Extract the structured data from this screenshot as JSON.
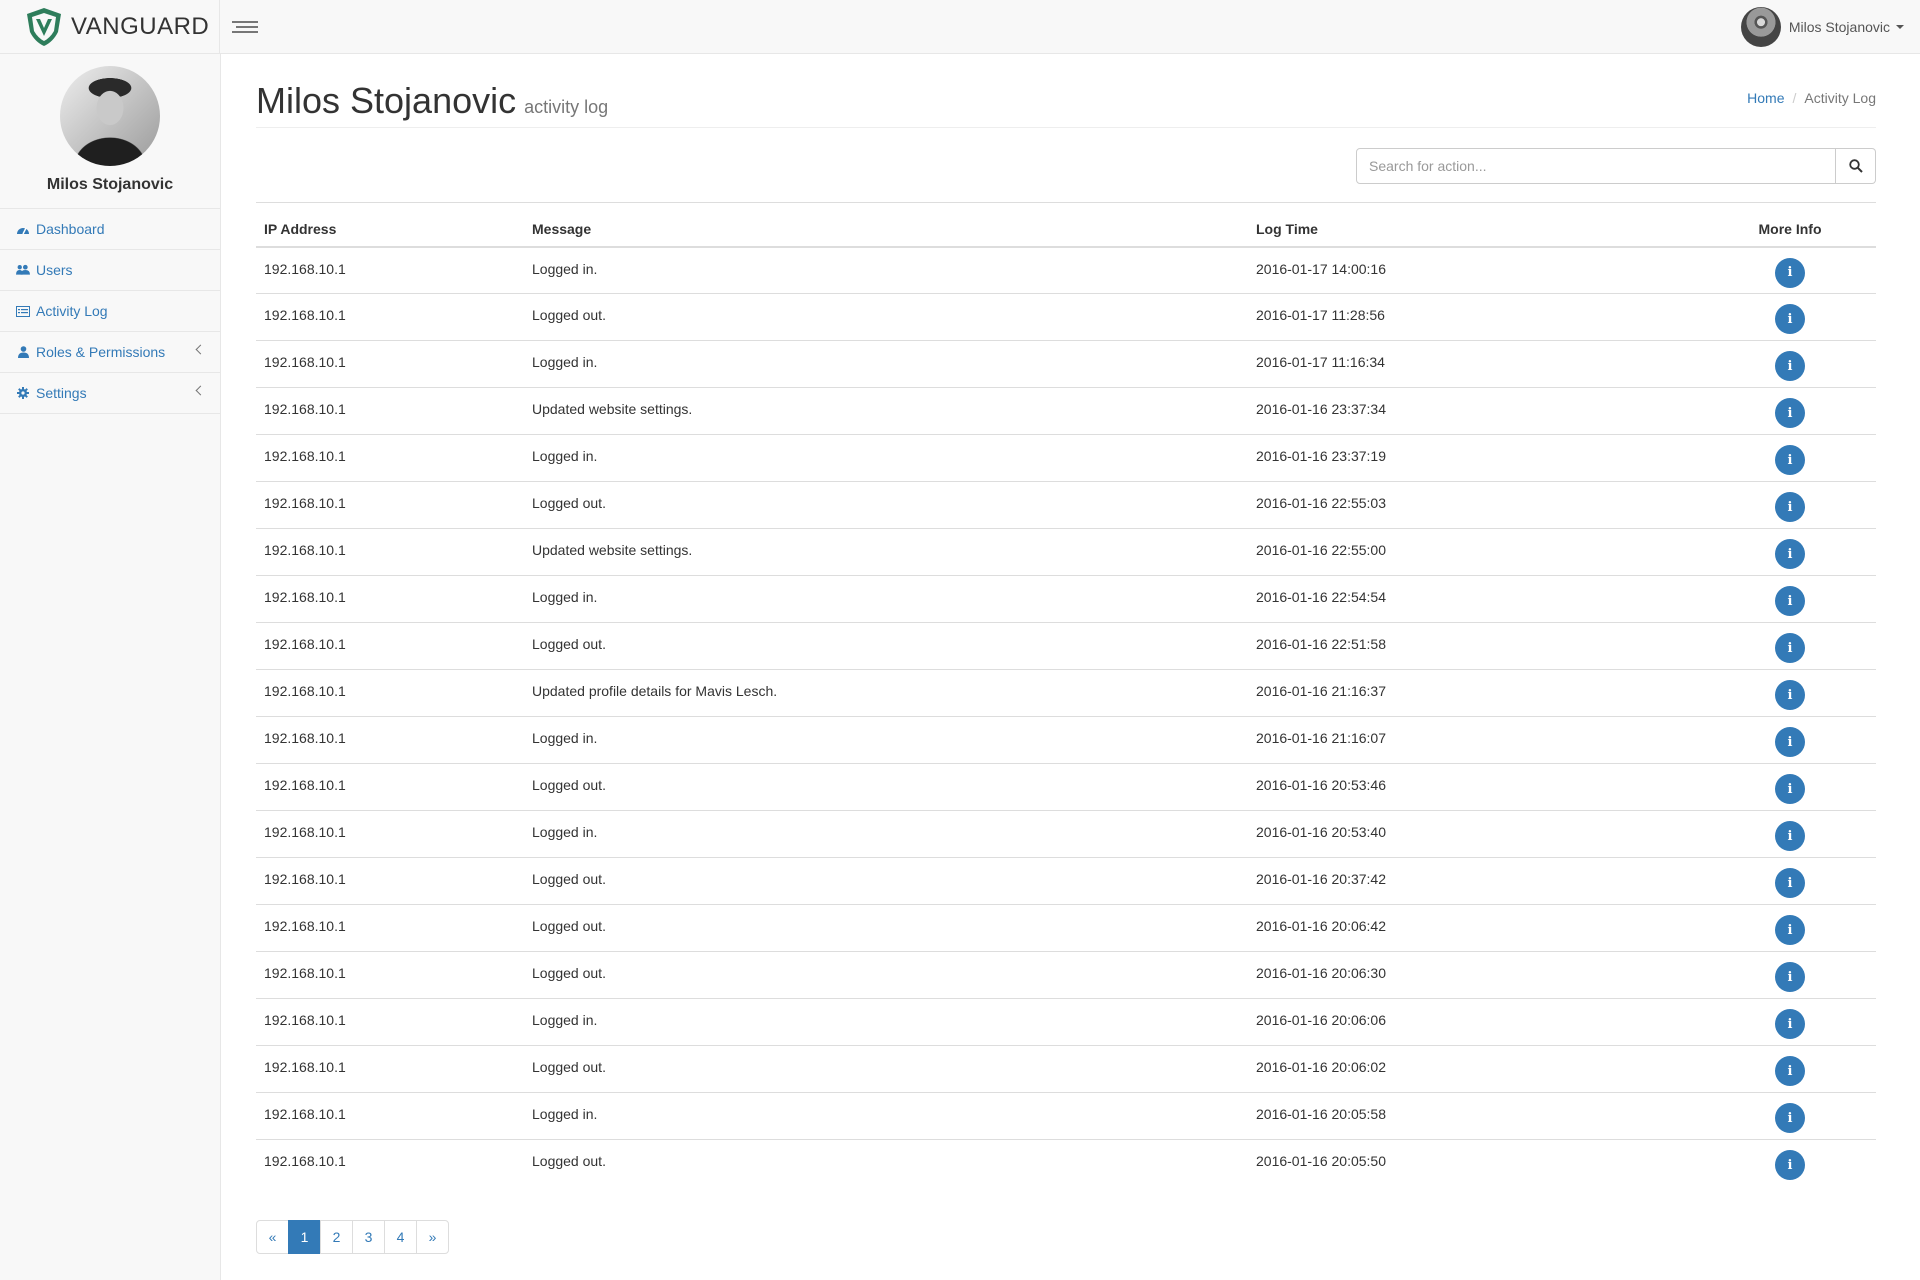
{
  "app": {
    "brand": "VANGUARD",
    "accent": "#337ab7",
    "logo_color": "#2e7d5b"
  },
  "navbar": {
    "user_name": "Milos Stojanovic",
    "toggle_icon": "menu-icon"
  },
  "sidebar": {
    "profile_name": "Milos Stojanovic",
    "items": [
      {
        "label": "Dashboard",
        "icon": "dashboard-icon",
        "has_submenu": false
      },
      {
        "label": "Users",
        "icon": "users-icon",
        "has_submenu": false
      },
      {
        "label": "Activity Log",
        "icon": "list-icon",
        "has_submenu": false
      },
      {
        "label": "Roles & Permissions",
        "icon": "user-icon",
        "has_submenu": true
      },
      {
        "label": "Settings",
        "icon": "gear-icon",
        "has_submenu": true
      }
    ]
  },
  "page": {
    "title": "Milos Stojanovic",
    "subtitle": "activity log",
    "breadcrumb": {
      "home": "Home",
      "current": "Activity Log"
    }
  },
  "search": {
    "placeholder": "Search for action...",
    "value": ""
  },
  "table": {
    "columns": [
      "IP Address",
      "Message",
      "Log Time",
      "More Info"
    ],
    "rows": [
      {
        "ip": "192.168.10.1",
        "message": "Logged in.",
        "time": "2016-01-17 14:00:16"
      },
      {
        "ip": "192.168.10.1",
        "message": "Logged out.",
        "time": "2016-01-17 11:28:56"
      },
      {
        "ip": "192.168.10.1",
        "message": "Logged in.",
        "time": "2016-01-17 11:16:34"
      },
      {
        "ip": "192.168.10.1",
        "message": "Updated website settings.",
        "time": "2016-01-16 23:37:34"
      },
      {
        "ip": "192.168.10.1",
        "message": "Logged in.",
        "time": "2016-01-16 23:37:19"
      },
      {
        "ip": "192.168.10.1",
        "message": "Logged out.",
        "time": "2016-01-16 22:55:03"
      },
      {
        "ip": "192.168.10.1",
        "message": "Updated website settings.",
        "time": "2016-01-16 22:55:00"
      },
      {
        "ip": "192.168.10.1",
        "message": "Logged in.",
        "time": "2016-01-16 22:54:54"
      },
      {
        "ip": "192.168.10.1",
        "message": "Logged out.",
        "time": "2016-01-16 22:51:58"
      },
      {
        "ip": "192.168.10.1",
        "message": "Updated profile details for Mavis Lesch.",
        "time": "2016-01-16 21:16:37"
      },
      {
        "ip": "192.168.10.1",
        "message": "Logged in.",
        "time": "2016-01-16 21:16:07"
      },
      {
        "ip": "192.168.10.1",
        "message": "Logged out.",
        "time": "2016-01-16 20:53:46"
      },
      {
        "ip": "192.168.10.1",
        "message": "Logged in.",
        "time": "2016-01-16 20:53:40"
      },
      {
        "ip": "192.168.10.1",
        "message": "Logged out.",
        "time": "2016-01-16 20:37:42"
      },
      {
        "ip": "192.168.10.1",
        "message": "Logged out.",
        "time": "2016-01-16 20:06:42"
      },
      {
        "ip": "192.168.10.1",
        "message": "Logged out.",
        "time": "2016-01-16 20:06:30"
      },
      {
        "ip": "192.168.10.1",
        "message": "Logged in.",
        "time": "2016-01-16 20:06:06"
      },
      {
        "ip": "192.168.10.1",
        "message": "Logged out.",
        "time": "2016-01-16 20:06:02"
      },
      {
        "ip": "192.168.10.1",
        "message": "Logged in.",
        "time": "2016-01-16 20:05:58"
      },
      {
        "ip": "192.168.10.1",
        "message": "Logged out.",
        "time": "2016-01-16 20:05:50"
      }
    ],
    "info_icon": "info-icon"
  },
  "pagination": {
    "prev": "«",
    "next": "»",
    "pages": [
      "1",
      "2",
      "3",
      "4"
    ],
    "current": "1"
  }
}
